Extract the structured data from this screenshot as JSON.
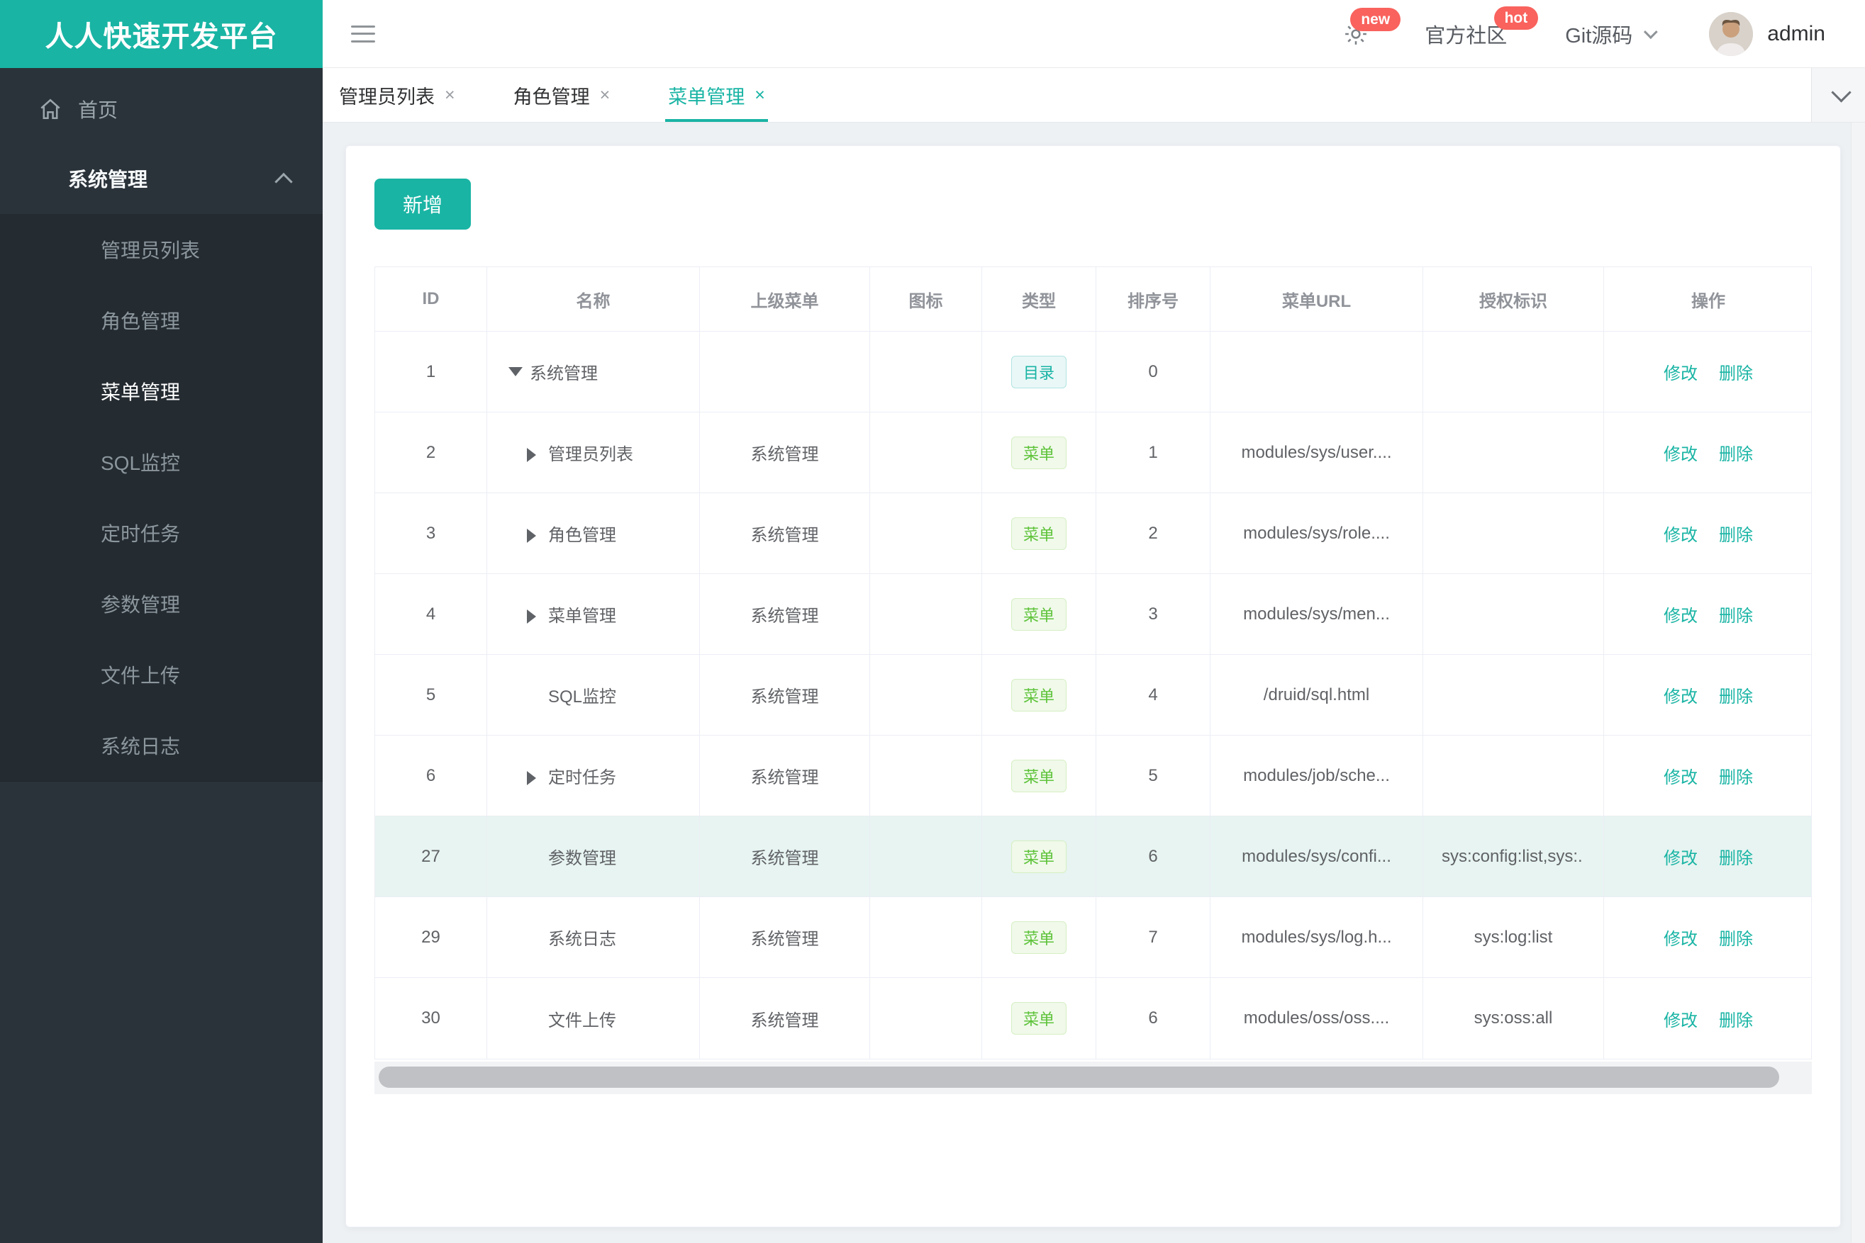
{
  "app": {
    "brand_color": "#19b4a4"
  },
  "logo": {
    "text": "人人快速开发平台"
  },
  "topbar": {
    "badge_new": "new",
    "community": "官方社区",
    "badge_hot": "hot",
    "git": "Git源码",
    "username": "admin"
  },
  "sidebar": {
    "home": "首页",
    "section": "系统管理",
    "items": [
      "管理员列表",
      "角色管理",
      "菜单管理",
      "SQL监控",
      "定时任务",
      "参数管理",
      "文件上传",
      "系统日志"
    ]
  },
  "tabs": [
    {
      "label": "管理员列表"
    },
    {
      "label": "角色管理"
    },
    {
      "label": "菜单管理"
    }
  ],
  "toolbar": {
    "add": "新增"
  },
  "table": {
    "columns": [
      "ID",
      "名称",
      "上级菜单",
      "图标",
      "类型",
      "排序号",
      "菜单URL",
      "授权标识",
      "操作"
    ],
    "action_edit": "修改",
    "action_delete": "删除",
    "rows": [
      {
        "id": "1",
        "name": "系统管理",
        "parent": "",
        "type": "目录",
        "sort": "0",
        "url": "",
        "perm": ""
      },
      {
        "id": "2",
        "name": "管理员列表",
        "parent": "系统管理",
        "type": "菜单",
        "sort": "1",
        "url": "modules/sys/user....",
        "perm": ""
      },
      {
        "id": "3",
        "name": "角色管理",
        "parent": "系统管理",
        "type": "菜单",
        "sort": "2",
        "url": "modules/sys/role....",
        "perm": ""
      },
      {
        "id": "4",
        "name": "菜单管理",
        "parent": "系统管理",
        "type": "菜单",
        "sort": "3",
        "url": "modules/sys/men...",
        "perm": ""
      },
      {
        "id": "5",
        "name": "SQL监控",
        "parent": "系统管理",
        "type": "菜单",
        "sort": "4",
        "url": "/druid/sql.html",
        "perm": ""
      },
      {
        "id": "6",
        "name": "定时任务",
        "parent": "系统管理",
        "type": "菜单",
        "sort": "5",
        "url": "modules/job/sche...",
        "perm": ""
      },
      {
        "id": "27",
        "name": "参数管理",
        "parent": "系统管理",
        "type": "菜单",
        "sort": "6",
        "url": "modules/sys/confi...",
        "perm": "sys:config:list,sys:."
      },
      {
        "id": "29",
        "name": "系统日志",
        "parent": "系统管理",
        "type": "菜单",
        "sort": "7",
        "url": "modules/sys/log.h...",
        "perm": "sys:log:list"
      },
      {
        "id": "30",
        "name": "文件上传",
        "parent": "系统管理",
        "type": "菜单",
        "sort": "6",
        "url": "modules/oss/oss....",
        "perm": "sys:oss:all"
      }
    ]
  }
}
